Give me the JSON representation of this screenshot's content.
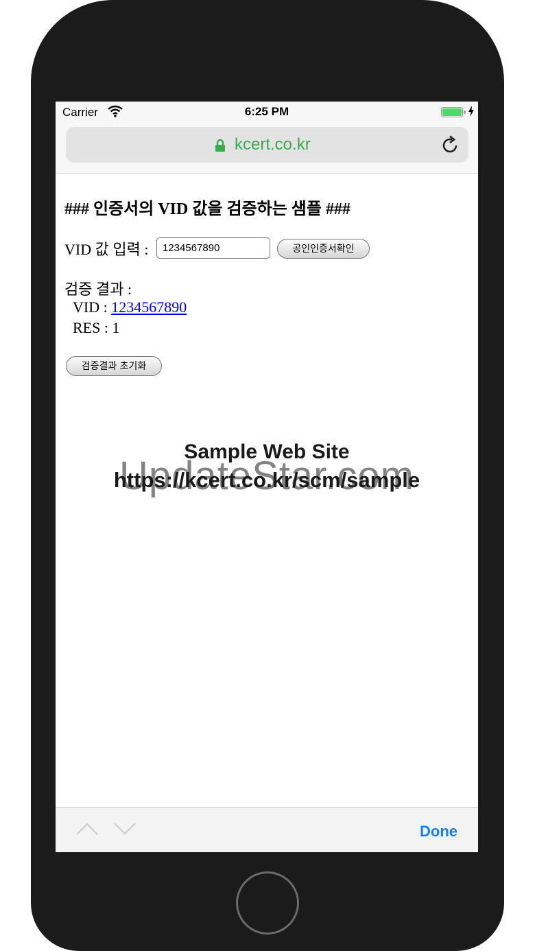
{
  "status": {
    "carrier": "Carrier",
    "time": "6:25 PM"
  },
  "browser": {
    "url": "kcert.co.kr"
  },
  "page": {
    "heading": "### 인증서의 VID 값을 검증하는 샘플 ###",
    "input_label": "VID 값 입력 :",
    "input_value": "1234567890",
    "verify_button": "공인인증서확인",
    "result_label": "검증 결과 :",
    "vid_prefix": "VID : ",
    "vid_value": "1234567890",
    "res_text": "RES : 1",
    "reset_button": "검증결과 초기화"
  },
  "overlay": {
    "title": "Sample Web Site",
    "url": "https://kcert.co.kr/scm/sample",
    "brand": "UpdateStar.com"
  },
  "toolbar": {
    "done": "Done"
  },
  "colors": {
    "accent": "#147efb",
    "url_green": "#3da94e",
    "link": "#0000ee",
    "battery": "#4cd964"
  },
  "icons": [
    "wifi-icon",
    "battery-icon",
    "charging-icon",
    "lock-icon",
    "reload-icon",
    "chevron-up-icon",
    "chevron-down-icon"
  ]
}
